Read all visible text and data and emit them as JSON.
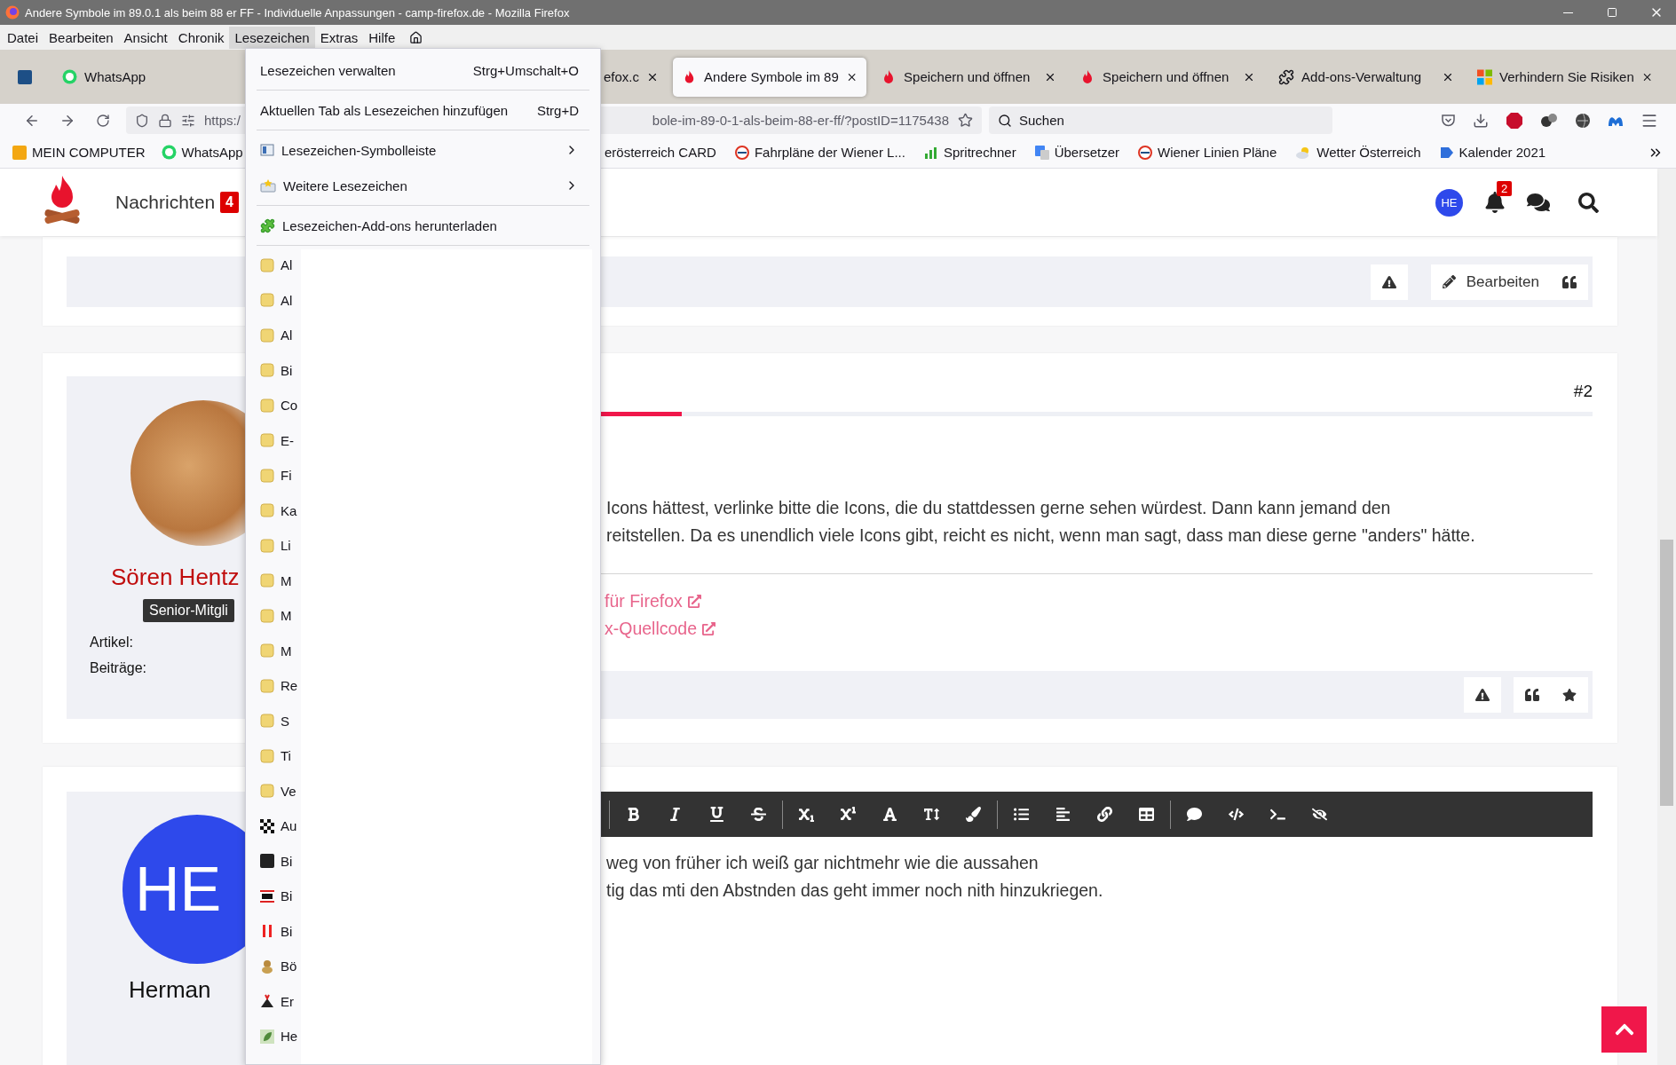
{
  "window": {
    "title": "Andere Symbole im 89.0.1 als beim 88 er FF - Individuelle Anpassungen - camp-firefox.de - Mozilla Firefox"
  },
  "menu_bar": [
    {
      "label": "Datei",
      "selected": false
    },
    {
      "label": "Bearbeiten",
      "selected": false
    },
    {
      "label": "Ansicht",
      "selected": false
    },
    {
      "label": "Chronik",
      "selected": false
    },
    {
      "label": "Lesezeichen",
      "selected": true
    },
    {
      "label": "Extras",
      "selected": false
    },
    {
      "label": "Hilfe",
      "selected": false
    }
  ],
  "tabs": [
    {
      "kind": "pinned",
      "selected": false
    },
    {
      "kind": "cut_right",
      "label": "WhatsApp",
      "selected": false
    },
    {
      "kind": "cut_left",
      "label": "efox.c",
      "selected": false
    },
    {
      "kind": "tab",
      "label": "Andere Symbole im 89",
      "selected": true
    },
    {
      "kind": "tab",
      "label": "Speichern und öffnen",
      "selected": false
    },
    {
      "kind": "tab",
      "label": "Speichern und öffnen",
      "selected": false
    },
    {
      "kind": "tab",
      "label": "Add-ons-Verwaltung",
      "selected": false
    },
    {
      "kind": "tab",
      "label": "Verhindern Sie Risiken",
      "selected": false
    }
  ],
  "address": {
    "start": "https:/",
    "end": "bole-im-89-0-1-als-beim-88-er-ff/?postID=1175438"
  },
  "search": {
    "placeholder": "Suchen"
  },
  "bookmarks_bar": [
    {
      "kind": "item",
      "label": "MEIN COMPUTER"
    },
    {
      "kind": "item",
      "label": "WhatsApp"
    },
    {
      "kind": "cut",
      "label": "erösterreich CARD"
    },
    {
      "kind": "item",
      "label": "Fahrpläne der Wiener L..."
    },
    {
      "kind": "item",
      "label": "Spritrechner"
    },
    {
      "kind": "item",
      "label": "Übersetzer"
    },
    {
      "kind": "item",
      "label": "Wiener Linien Pläne"
    },
    {
      "kind": "item",
      "label": "Wetter Österreich"
    },
    {
      "kind": "item",
      "label": "Kalender 2021"
    }
  ],
  "site_header": {
    "nav_label": "Nachrichten",
    "nav_badge": "4",
    "avatar": "HE",
    "notification_badge": "2"
  },
  "bookmarks_menu": {
    "items": [
      {
        "kind": "command",
        "label": "Lesezeichen verwalten",
        "shortcut": "Strg+Umschalt+O"
      },
      {
        "kind": "separator"
      },
      {
        "kind": "command",
        "label": "Aktuellen Tab als Lesezeichen hinzufügen",
        "shortcut": "Strg+D"
      },
      {
        "kind": "separator"
      },
      {
        "kind": "submenu",
        "label": "Lesezeichen-Symbolleiste"
      },
      {
        "kind": "submenu",
        "label": "Weitere Lesezeichen"
      },
      {
        "kind": "separator"
      },
      {
        "kind": "addon",
        "label": "Lesezeichen-Add-ons herunterladen"
      },
      {
        "kind": "separator"
      }
    ],
    "entries": [
      {
        "kind": "folder",
        "label": "Al"
      },
      {
        "kind": "folder",
        "label": "Al"
      },
      {
        "kind": "folder",
        "label": "Al"
      },
      {
        "kind": "folder",
        "label": "Bi"
      },
      {
        "kind": "folder",
        "label": "Co"
      },
      {
        "kind": "folder",
        "label": "E-"
      },
      {
        "kind": "folder",
        "label": "Fi"
      },
      {
        "kind": "folder",
        "label": "Ka"
      },
      {
        "kind": "folder",
        "label": "Li"
      },
      {
        "kind": "folder",
        "label": "M"
      },
      {
        "kind": "folder",
        "label": "M"
      },
      {
        "kind": "folder",
        "label": "M"
      },
      {
        "kind": "folder",
        "label": "Re"
      },
      {
        "kind": "folder",
        "label": "S"
      },
      {
        "kind": "folder",
        "label": "Ti"
      },
      {
        "kind": "folder",
        "label": "Ve"
      },
      {
        "kind": "bookmark",
        "label": "Au"
      },
      {
        "kind": "bookmark",
        "label": "Bi"
      },
      {
        "kind": "bookmark",
        "label": "Bi"
      },
      {
        "kind": "bookmark",
        "label": "Bi"
      },
      {
        "kind": "bookmark",
        "label": "Bö"
      },
      {
        "kind": "bookmark",
        "label": "Er"
      },
      {
        "kind": "bookmark",
        "label": "He"
      }
    ]
  },
  "posts": [
    {
      "kind": "footer_only",
      "actions": [
        {
          "kind": "report"
        },
        {
          "kind": "edit",
          "label": "Bearbeiten"
        },
        {
          "kind": "quote"
        }
      ]
    },
    {
      "kind": "post",
      "number": "#2",
      "author": {
        "name": "Sören Hentz",
        "rank": "Senior-Mitgli",
        "stats": [
          "Artikel:",
          "Beiträge:"
        ]
      },
      "body": [
        "Icons hättest, verlinke bitte die Icons, die du stattdessen gerne sehen würdest. Dann kann jemand den",
        "reitstellen. Da es unendlich viele Icons gibt, reicht es nicht, wenn man sagt, dass man diese gerne \"anders\" hätte."
      ],
      "links": [
        "für Firefox",
        "x-Quellcode"
      ],
      "actions": [
        {
          "kind": "report"
        },
        {
          "kind": "quote"
        },
        {
          "kind": "like"
        }
      ]
    },
    {
      "kind": "editor",
      "author": {
        "initials": "HE",
        "name": "Herman"
      },
      "lines": [
        "weg von früher ich weiß gar nichtmehr wie die aussahen",
        "tig das mti den Abstnden das geht immer noch nith hinzukriegen."
      ]
    }
  ]
}
